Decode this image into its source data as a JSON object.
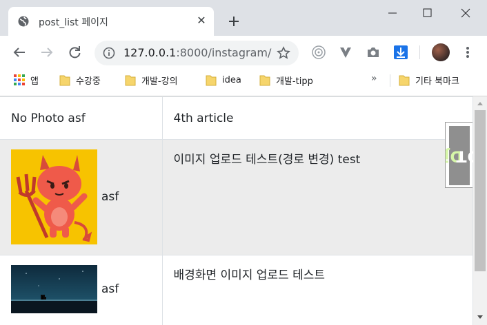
{
  "browser": {
    "tab": {
      "title": "post_list 페이지",
      "close": "✕"
    },
    "new_tab": "+",
    "url": {
      "host": "127.0.0.1",
      "rest": ":8000/instagram/"
    },
    "bookmarks": [
      {
        "label": "앱",
        "icon": "apps-grid-icon"
      },
      {
        "label": "수강중",
        "icon": "folder-icon"
      },
      {
        "label": "개발-강의",
        "icon": "folder-icon"
      },
      {
        "label": "idea",
        "icon": "folder-icon"
      },
      {
        "label": "개발-tipp",
        "icon": "folder-icon"
      }
    ],
    "bookmarks_more": "»",
    "other_bookmarks": "기타 북마크"
  },
  "posts": {
    "rows": [
      {
        "author": "No Photo asf",
        "message": "4th article",
        "photo": null
      },
      {
        "author": "asf",
        "message": "이미지 업로드 테스트(경로 변경) test",
        "photo": "devil-cartoon"
      },
      {
        "author": "asf",
        "message": "배경화면 이미지 업로드 테스트",
        "photo": "night-landscape"
      }
    ]
  },
  "debug_toolbar": {
    "label_dj": "Dj",
    "label_dt": "DT"
  },
  "colors": {
    "tab_strip": "#dee1e6",
    "row_highlight": "#ececec",
    "folder": "#f6d56c"
  }
}
